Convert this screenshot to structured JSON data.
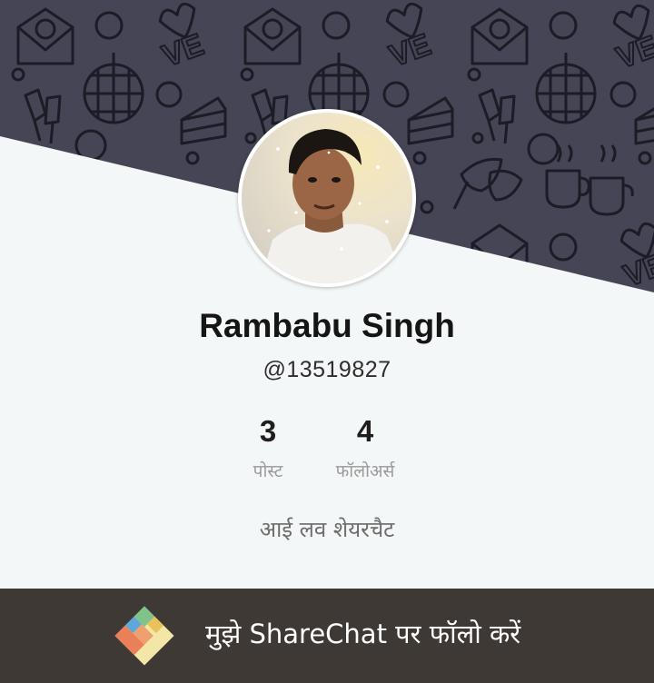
{
  "profile": {
    "name": "Rambabu Singh",
    "handle": "@13519827",
    "bio": "आई लव शेयरचैट"
  },
  "stats": [
    {
      "value": "3",
      "label": "पोस्ट"
    },
    {
      "value": "4",
      "label": "फॉलोअर्स"
    }
  ],
  "footer": {
    "cta_label": "मुझे ShareChat पर फॉलो करें"
  },
  "colors": {
    "banner_bg": "#454555",
    "page_bg": "#f4f7f7",
    "footer_bg": "#3f3935"
  },
  "icons": {
    "banner_pattern": [
      "envelope-heart-icon",
      "love-text-icon",
      "disco-ball-icon",
      "champagne-glasses-icon",
      "cake-slice-icon",
      "masks-icon",
      "coffee-cups-icon"
    ],
    "logo": "sharechat-logo"
  }
}
